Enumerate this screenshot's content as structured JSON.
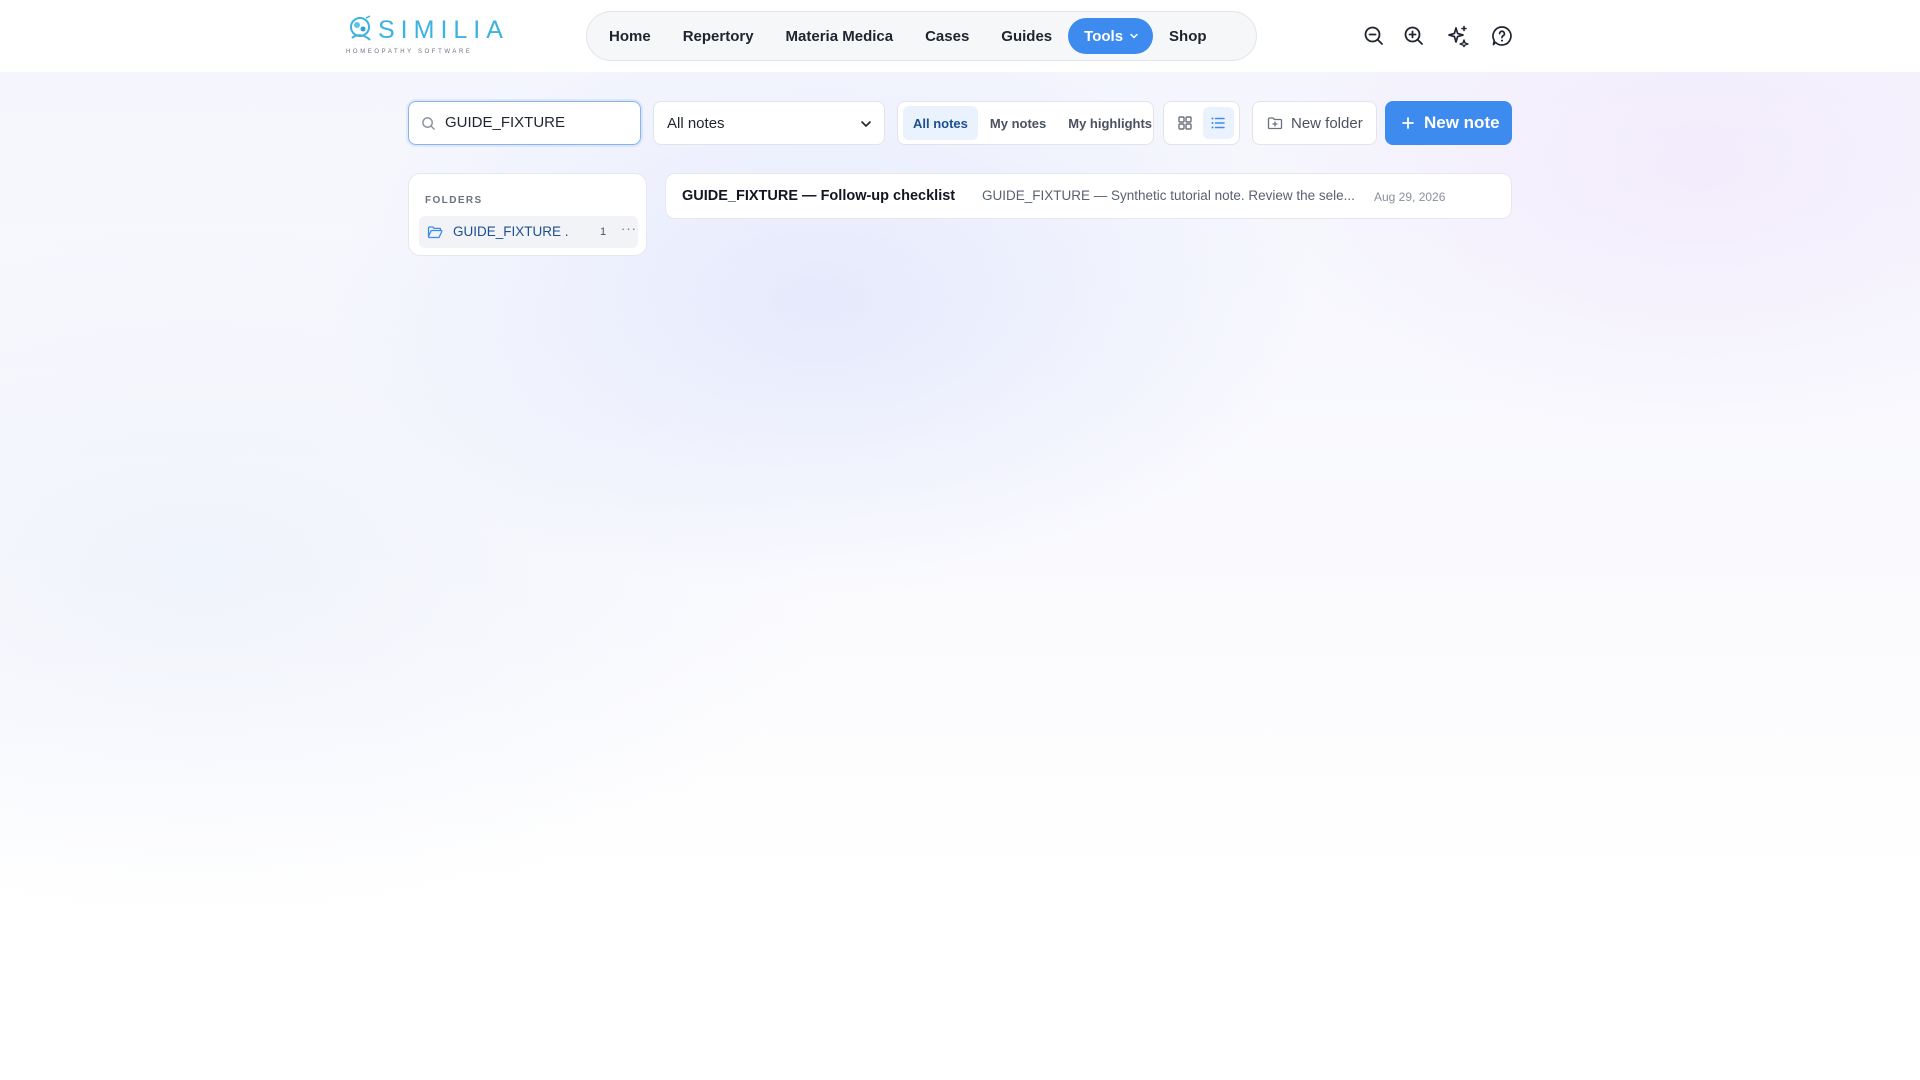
{
  "brand": {
    "name": "SIMILIA",
    "tagline": "HOMEOPATHY SOFTWARE",
    "color": "#3cb2e0"
  },
  "nav": {
    "items": [
      {
        "label": "Home"
      },
      {
        "label": "Repertory"
      },
      {
        "label": "Materia Medica"
      },
      {
        "label": "Cases"
      },
      {
        "label": "Guides"
      },
      {
        "label": "Tools",
        "active": true
      },
      {
        "label": "Shop"
      }
    ]
  },
  "header_icons": [
    "zoom-out-icon",
    "zoom-in-icon",
    "sparkles-icon",
    "help-icon"
  ],
  "toolbar": {
    "search": {
      "value": "GUIDE_FIXTURE",
      "placeholder": "Search notes"
    },
    "filter_select": {
      "value": "All notes"
    },
    "segment": {
      "options": [
        "All notes",
        "My notes",
        "My highlights"
      ],
      "selected": "All notes"
    },
    "view_mode": "list",
    "new_folder_label": "New folder",
    "new_note_label": "New note"
  },
  "folders": {
    "title": "FOLDERS",
    "items": [
      {
        "name": "GUIDE_FIXTURE ...",
        "count": "1",
        "more": "···"
      }
    ]
  },
  "notes": [
    {
      "title": "GUIDE_FIXTURE — Follow-up checklist",
      "snippet": "GUIDE_FIXTURE — Synthetic tutorial note. Review the sele...",
      "date": "Aug 29, 2026"
    }
  ],
  "colors": {
    "accent": "#3e8bf0",
    "accent_soft": "#eaf2fd",
    "text": "#1f2430"
  }
}
